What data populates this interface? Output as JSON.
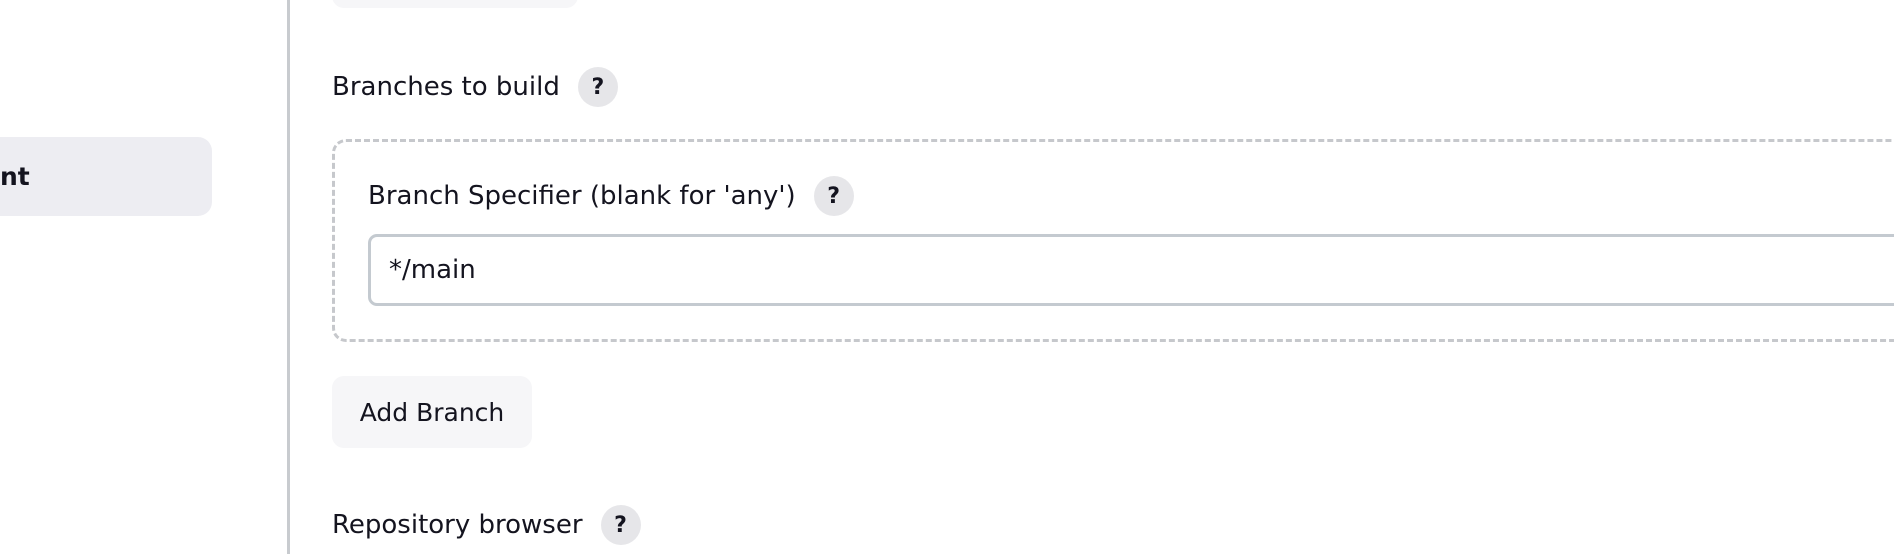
{
  "sidebar": {
    "active_item_label": "nt"
  },
  "branches": {
    "label": "Branches to build",
    "help_label": "?",
    "specifier": {
      "label": "Branch Specifier (blank for 'any')",
      "help_label": "?",
      "value": "*/main"
    },
    "add_button_label": "Add Branch"
  },
  "repository_browser": {
    "label": "Repository browser",
    "help_label": "?"
  }
}
